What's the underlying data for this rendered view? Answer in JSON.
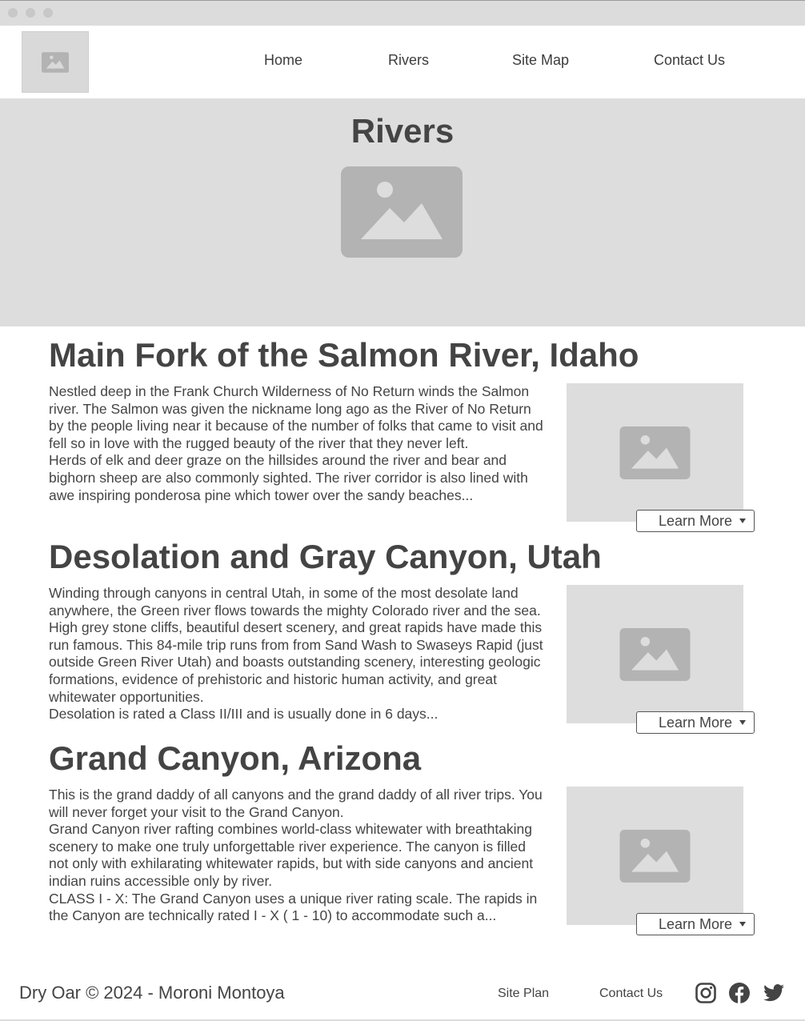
{
  "nav": {
    "items": [
      {
        "label": "Home"
      },
      {
        "label": "Rivers"
      },
      {
        "label": "Site Map"
      },
      {
        "label": "Contact Us"
      }
    ]
  },
  "hero": {
    "title": "Rivers"
  },
  "sections": [
    {
      "title": "Main Fork of the Salmon River, Idaho",
      "paragraphs": [
        "Nestled deep in the Frank Church Wilderness of No Return winds the Salmon river. The Salmon was given the nickname long ago as the River of No Return by the people living near it because of the number of folks that came to visit and fell so in love with the rugged beauty of the river that they never left.",
        "Herds of elk and deer graze on the hillsides around the river and bear and bighorn sheep are also commonly sighted. The river corridor is also lined with awe inspiring ponderosa pine which tower over the sandy beaches..."
      ],
      "button": "Learn More"
    },
    {
      "title": "Desolation and Gray Canyon, Utah",
      "paragraphs": [
        "Winding through canyons in central Utah, in some of the most desolate land anywhere, the Green river flows towards the mighty Colorado river and the sea. High grey stone cliffs, beautiful desert scenery, and great rapids have made this run famous. This 84-mile trip runs from from Sand Wash to Swaseys Rapid (just outside Green River Utah) and boasts outstanding scenery, interesting geologic formations, evidence of prehistoric and historic human activity, and great whitewater opportunities.",
        "Desolation is rated a Class II/III and is usually done in 6 days..."
      ],
      "button": "Learn More"
    },
    {
      "title": "Grand Canyon, Arizona",
      "paragraphs": [
        "This is the grand daddy of all canyons and the grand daddy of all river trips. You will never forget your visit to the Grand Canyon.",
        "Grand Canyon river rafting combines world-class whitewater with breathtaking scenery to make one truly unforgettable river experience. The canyon is filled not only with exhilarating whitewater rapids, but with side canyons and ancient indian ruins accessible only by river.",
        "CLASS I - X: The Grand Canyon uses a unique river rating scale. The rapids in the Canyon are technically rated I - X ( 1 - 10) to accommodate such a..."
      ],
      "button": "Learn More"
    }
  ],
  "footer": {
    "copyright": "Dry Oar © 2024 - Moroni Montoya",
    "links": [
      {
        "label": "Site Plan"
      },
      {
        "label": "Contact Us"
      }
    ],
    "social": [
      "instagram-icon",
      "facebook-icon",
      "twitter-icon"
    ]
  },
  "colors": {
    "text": "#444444",
    "placeholder_bg": "#dddddd",
    "placeholder_icon": "#b3b3b3"
  }
}
